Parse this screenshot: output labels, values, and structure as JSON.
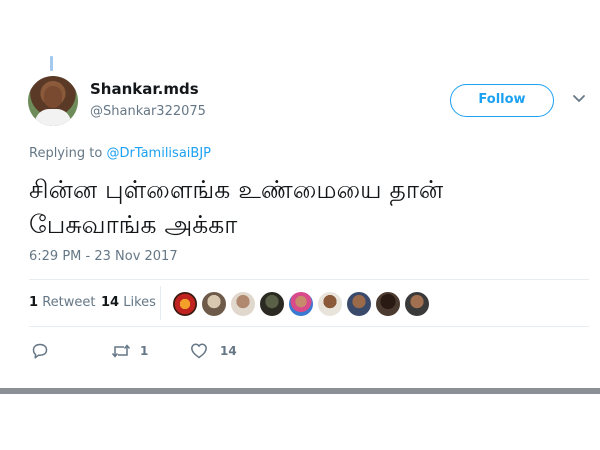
{
  "tweet": {
    "author": {
      "display_name": "Shankar.mds",
      "handle": "@Shankar322075"
    },
    "follow_label": "Follow",
    "replying_prefix": "Replying to",
    "replying_to": "@DrTamilisaiBJP",
    "text_line1": "சின்ன புள்ளைங்க உண்மையை தான்",
    "text_line2": "பேசுவாங்க அக்கா",
    "timestamp": "6:29 PM - 23 Nov 2017",
    "stats": {
      "retweets_count": "1",
      "retweets_label": "Retweet",
      "likes_count": "14",
      "likes_label": "Likes"
    },
    "actions": {
      "retweet_count": "1",
      "like_count": "14"
    }
  },
  "colors": {
    "accent": "#1da1f2",
    "secondary_text": "#657786",
    "divider": "#e6ecf0"
  },
  "icons": [
    "chevron-down-icon",
    "reply-icon",
    "retweet-icon",
    "heart-icon"
  ]
}
